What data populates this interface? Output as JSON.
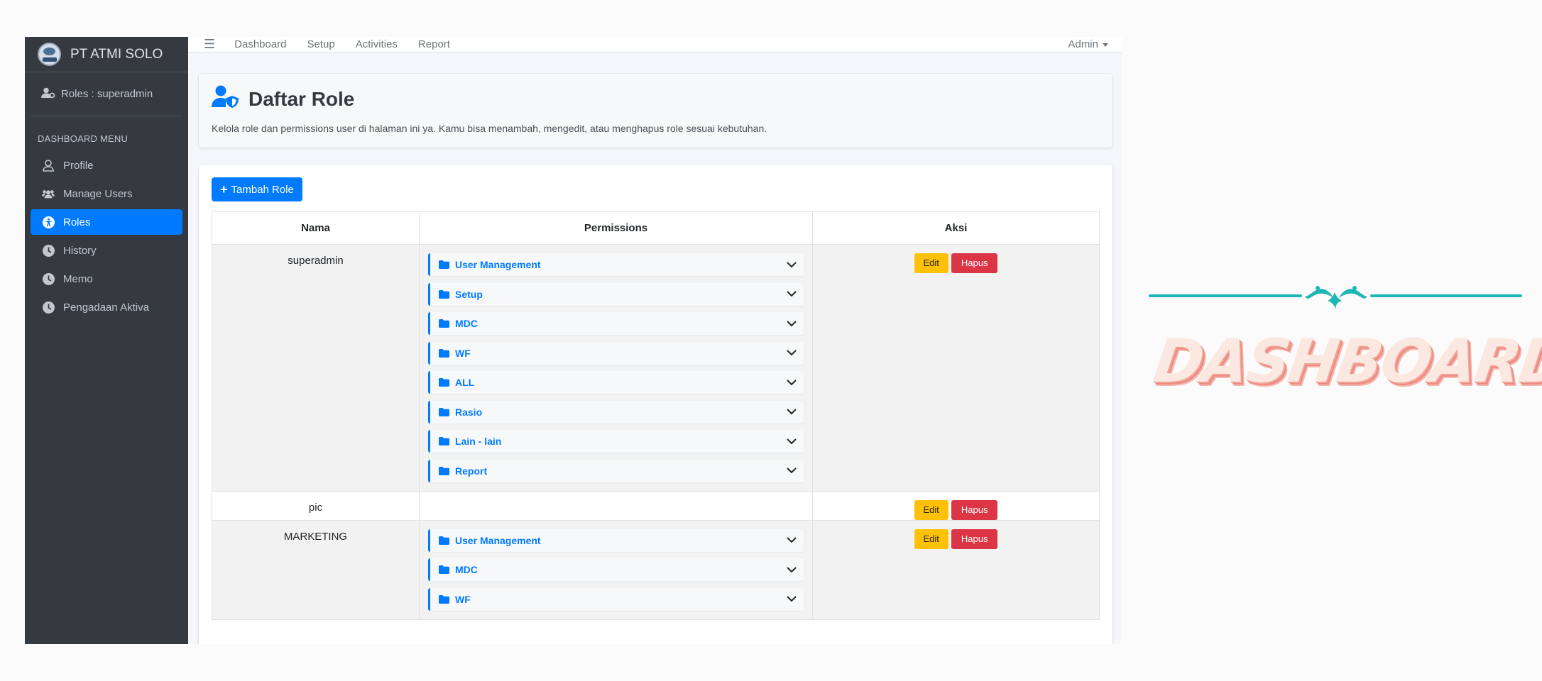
{
  "brand": {
    "name": "PT ATMI SOLO"
  },
  "user": {
    "label": "Roles : superadmin"
  },
  "sidebar": {
    "header": "DASHBOARD MENU",
    "items": [
      {
        "label": "Profile",
        "icon": "user-icon"
      },
      {
        "label": "Manage Users",
        "icon": "users-icon"
      },
      {
        "label": "Roles",
        "icon": "accessibility-icon",
        "active": true
      },
      {
        "label": "History",
        "icon": "clock-icon"
      },
      {
        "label": "Memo",
        "icon": "clock-icon"
      },
      {
        "label": "Pengadaan Aktiva",
        "icon": "clock-icon"
      }
    ]
  },
  "topnav": {
    "links": [
      "Dashboard",
      "Setup",
      "Activities",
      "Report"
    ],
    "account": "Admin"
  },
  "page": {
    "title": "Daftar Role",
    "description": "Kelola role dan permissions user di halaman ini ya. Kamu bisa menambah, mengedit, atau menghapus role sesuai kebutuhan.",
    "add_button": "Tambah Role"
  },
  "table": {
    "headers": [
      "Nama",
      "Permissions",
      "Aksi"
    ],
    "edit_label": "Edit",
    "delete_label": "Hapus",
    "rows": [
      {
        "name": "superadmin",
        "permissions": [
          "User Management",
          "Setup",
          "MDC",
          "WF",
          "ALL",
          "Rasio",
          "Lain - lain",
          "Report"
        ]
      },
      {
        "name": "pic",
        "permissions": []
      },
      {
        "name": "MARKETING",
        "permissions": [
          "User Management",
          "MDC",
          "WF"
        ]
      }
    ]
  },
  "decoration": {
    "text": "DASHBOARD"
  },
  "colors": {
    "primary": "#007bff",
    "sidebar": "#343a40",
    "warning": "#ffc107",
    "danger": "#dc3545",
    "teal": "#1fb7b4"
  }
}
